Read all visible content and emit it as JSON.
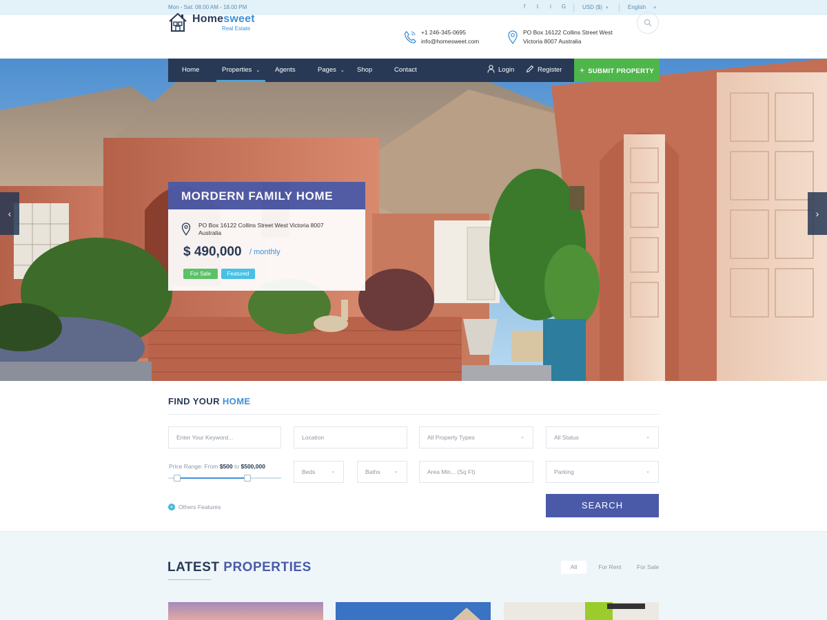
{
  "topbar": {
    "hours": "Mon - Sat: 08.00 AM - 18.00 PM",
    "socials": [
      "f",
      "t",
      "i",
      "G"
    ],
    "social_icons": [
      "facebook-icon",
      "twitter-icon",
      "instagram-icon",
      "google-icon"
    ],
    "currency": "USD ($)",
    "language": "English"
  },
  "header": {
    "logo_main": "Home",
    "logo_accent": "sweet",
    "logo_tagline": "Real Estate",
    "phone": "+1 246-345-0695",
    "email": "info@homesweet.com",
    "address_line1": "PO Box 16122 Collins Street West",
    "address_line2": "Victoria 8007 Australia"
  },
  "nav": {
    "items": [
      "Home",
      "Properties",
      "Agents",
      "Pages",
      "Shop",
      "Contact"
    ],
    "login": "Login",
    "register": "Register",
    "submit_plus": "+",
    "submit": "SUBMIT PROPERTY"
  },
  "hero_card": {
    "title": "MORDERN FAMILY HOME",
    "address": "PO Box 16122 Collins Street West Victoria 8007 Australia",
    "price": "$ 490,000",
    "period": "/ monthly",
    "tags": [
      "For Sale",
      "Featured"
    ]
  },
  "search": {
    "title_main": "FIND YOUR",
    "title_accent": "HOME",
    "keyword_placeholder": "Enter Your Keyword...",
    "location_placeholder": "Location",
    "property_types": "All Property Types",
    "status": "All Status",
    "price_prefix": "Price Range: From",
    "price_from": "$500",
    "price_to_word": "to",
    "price_to": "$500,000",
    "price_range_fraction": [
      0.08,
      0.7
    ],
    "beds": "Beds",
    "baths": "Baths",
    "area_placeholder": "Area Min... (Sq Ft)",
    "parking": "Parking",
    "others_plus": "+",
    "others": "Others Features",
    "button": "SEARCH"
  },
  "latest": {
    "title_main": "LATEST",
    "title_accent": "PROPERTIES",
    "filters": [
      "All",
      "For Rent",
      "For Sale"
    ]
  },
  "colors": {
    "navy": "#273955",
    "indigo": "#4a5aa8",
    "blue_accent": "#3e8fd6",
    "green": "#4fb64b",
    "tag_green": "#5cc168",
    "tag_blue": "#46c1e6"
  }
}
